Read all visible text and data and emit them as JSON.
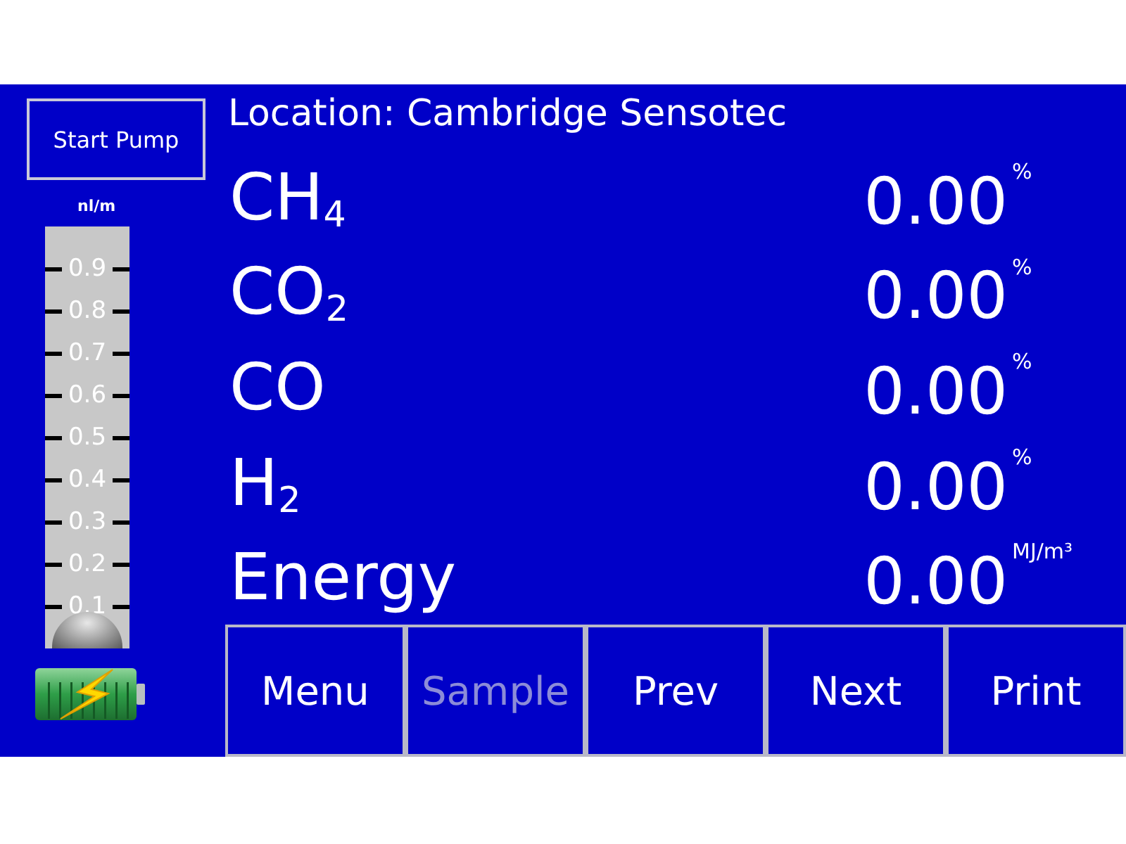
{
  "header": {
    "location": "Location: Cambridge Sensotec"
  },
  "pump_button": {
    "label": "Start Pump"
  },
  "flow_gauge": {
    "unit": "nl/m",
    "ticks": [
      "0.9",
      "0.8",
      "0.7",
      "0.6",
      "0.5",
      "0.4",
      "0.3",
      "0.2",
      "0.1"
    ],
    "level": 0
  },
  "readings": [
    {
      "name": "CH$_{4}$",
      "value": "0.00",
      "unit": "%"
    },
    {
      "name": "CO$_{2}$",
      "value": "0.00",
      "unit": "%"
    },
    {
      "name": "CO",
      "value": "0.00",
      "unit": "%"
    },
    {
      "name": "H$_{2}$",
      "value": "0.00",
      "unit": "%"
    },
    {
      "name": "Energy",
      "value": "0.00",
      "unit": "MJ/m³"
    }
  ],
  "buttons": [
    {
      "label": "Menu",
      "disabled": false
    },
    {
      "label": "Sample",
      "disabled": true
    },
    {
      "label": "Prev",
      "disabled": false
    },
    {
      "label": "Next",
      "disabled": false
    },
    {
      "label": "Print",
      "disabled": false
    }
  ]
}
